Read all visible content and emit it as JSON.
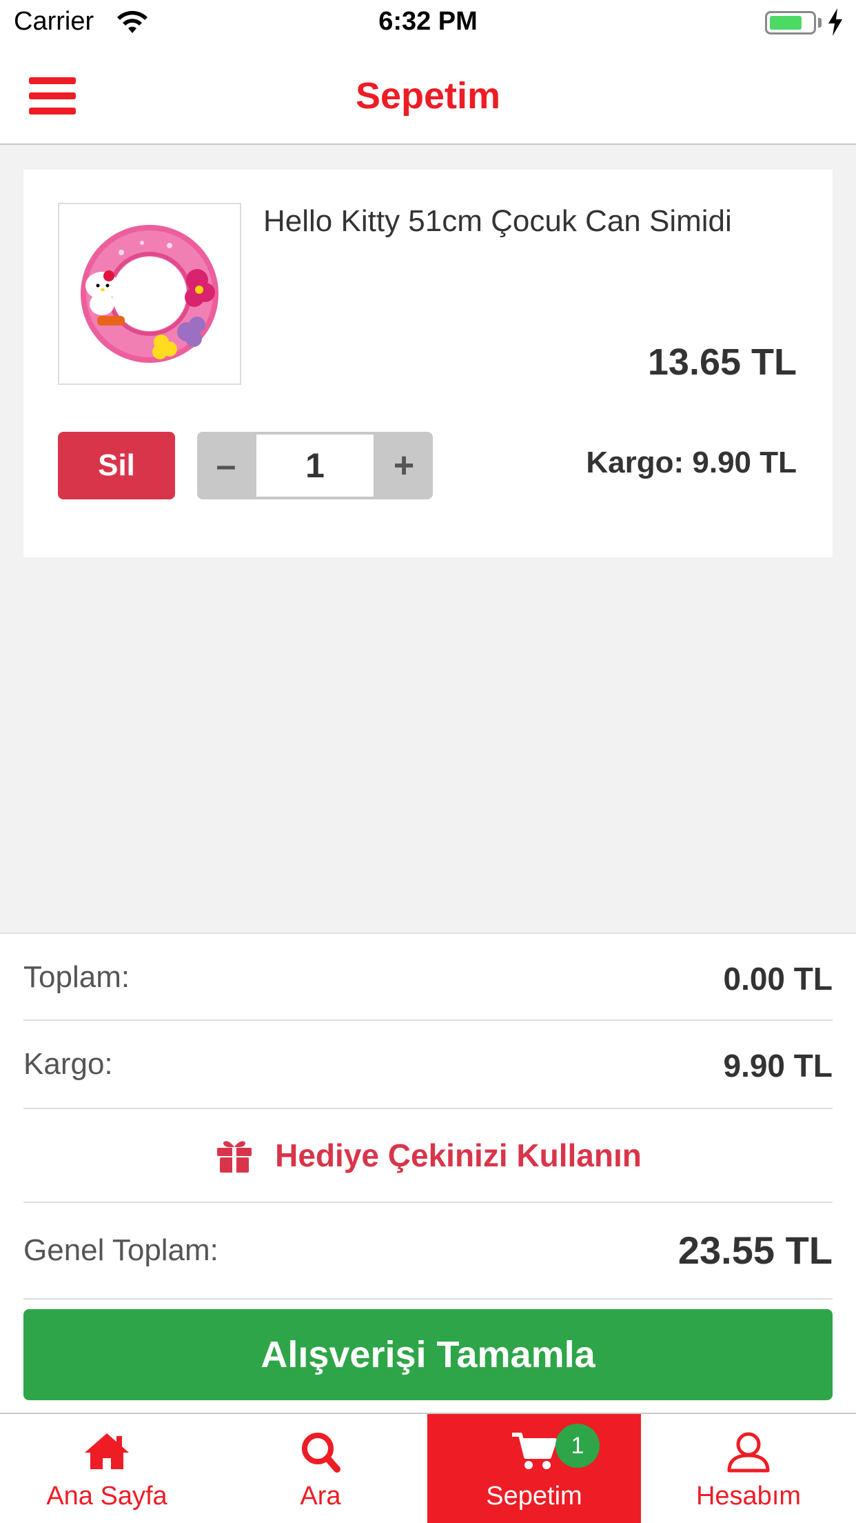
{
  "status_bar": {
    "carrier": "Carrier",
    "time": "6:32 PM",
    "battery_color": "#4cd964"
  },
  "nav": {
    "title": "Sepetim",
    "menu_icon": "hamburger-menu-icon",
    "accent_color": "#ee1c25"
  },
  "cart": {
    "items": [
      {
        "name": "Hello Kitty 51cm Çocuk Can Simidi",
        "price": "13.65 TL",
        "quantity": "1",
        "shipping": "Kargo: 9.90 TL",
        "delete_label": "Sil",
        "minus_label": "–",
        "plus_label": "+"
      }
    ]
  },
  "summary": {
    "subtotal_label": "Toplam:",
    "subtotal_value": "0.00 TL",
    "shipping_label": "Kargo:",
    "shipping_value": "9.90 TL",
    "gift_label": "Hediye Çekinizi Kullanın",
    "grand_total_label": "Genel Toplam:",
    "grand_total_value": "23.55 TL",
    "checkout_label": "Alışverişi Tamamla",
    "checkout_color": "#2ea548",
    "delete_color": "#d9354a"
  },
  "tab_bar": {
    "tabs": [
      {
        "label": "Ana Sayfa",
        "icon": "home-icon",
        "active": false
      },
      {
        "label": "Ara",
        "icon": "search-icon",
        "active": false
      },
      {
        "label": "Sepetim",
        "icon": "cart-icon",
        "active": true,
        "badge": "1"
      },
      {
        "label": "Hesabım",
        "icon": "user-icon",
        "active": false
      }
    ]
  }
}
